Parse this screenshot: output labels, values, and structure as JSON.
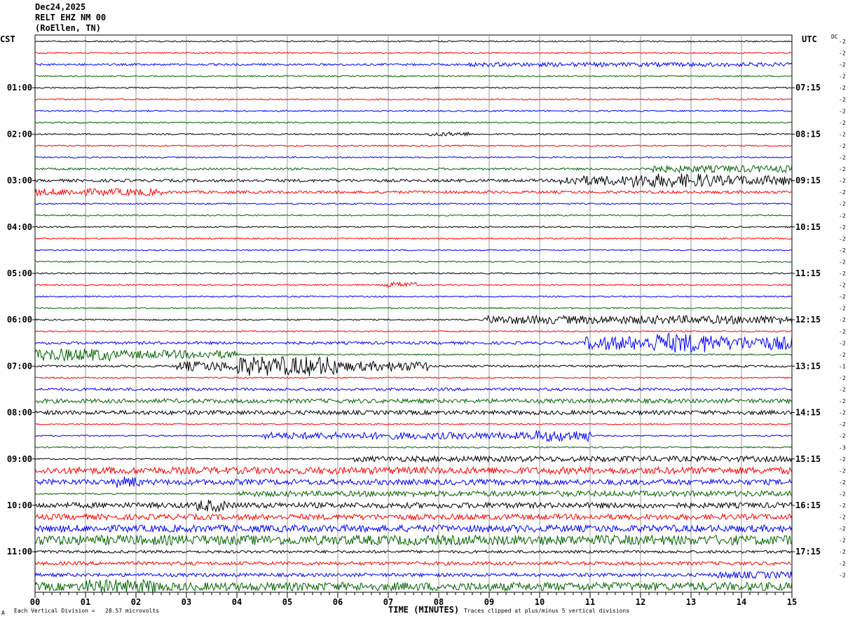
{
  "header": {
    "date": "Dec24,2025",
    "station": "RELT EHZ NM 00",
    "location": "(RoEllen, TN)"
  },
  "left_label": "CST",
  "right_label": "UTC",
  "dc_label": "DC",
  "footer": {
    "scale_text": "Each Vertical Division =   28.57 microvolts",
    "xlabel": "TIME (MINUTES)",
    "clip_text": "Traces clipped at plus/minus 5 vertical divisions",
    "corner_mark": "A"
  },
  "colors": {
    "cycle": [
      "#000000",
      "#ff0000",
      "#0000ff",
      "#006400"
    ],
    "grid": "#999999"
  },
  "chart_data": {
    "type": "line",
    "title": "RELT EHZ NM 00",
    "xlabel": "TIME (MINUTES)",
    "xlim": [
      0,
      15
    ],
    "xticks": [
      "00",
      "01",
      "02",
      "03",
      "04",
      "05",
      "06",
      "07",
      "08",
      "09",
      "10",
      "11",
      "12",
      "13",
      "14",
      "15"
    ],
    "cst_labels": [
      "01:00",
      "02:00",
      "03:00",
      "04:00",
      "05:00",
      "06:00",
      "07:00",
      "08:00",
      "09:00",
      "10:00",
      "11:00"
    ],
    "utc_labels": [
      "07:15",
      "08:15",
      "09:15",
      "10:15",
      "11:15",
      "12:15",
      "13:15",
      "14:15",
      "15:15",
      "16:15",
      "17:15"
    ],
    "dc_offsets": [
      "-2",
      "-2",
      "-2",
      "-2",
      "-2",
      "-2",
      "-2",
      "-2",
      "-2",
      "-2",
      "-2",
      "-2",
      "-2",
      "-2",
      "-2",
      "-2",
      "-2",
      "-2",
      "-2",
      "-2",
      "-2",
      "-2",
      "-2",
      "-2",
      "-2",
      "-2",
      "-2",
      "-2",
      "-1",
      "-2",
      "-2",
      "-2",
      "-2",
      "-2",
      "-2",
      "-3",
      "-2",
      "-2",
      "-2",
      "-2",
      "-2",
      "-2",
      "-2",
      "-2",
      "-2",
      "-2",
      "-2"
    ],
    "trace_count": 48,
    "trace_amplitude": [
      1,
      1,
      1.5,
      1,
      1,
      1,
      1,
      1,
      1,
      1,
      1,
      1.5,
      2,
      2,
      1,
      1,
      1,
      1,
      1,
      1,
      1,
      1,
      1,
      1,
      1,
      1,
      2,
      1,
      1.5,
      1,
      2,
      3,
      3,
      1,
      1,
      1,
      1,
      1,
      1,
      1,
      1,
      1,
      2,
      1,
      2,
      2.5,
      2.5,
      2.5,
      2,
      2.5,
      2.5,
      2.5,
      3,
      1,
      1,
      1,
      2,
      2.5
    ],
    "events": [
      {
        "trace": 2,
        "start": 8.6,
        "end": 15,
        "amp": 3
      },
      {
        "trace": 8,
        "start": 7.8,
        "end": 8.6,
        "amp": 3
      },
      {
        "trace": 11,
        "start": 12.0,
        "end": 15,
        "amp": 5
      },
      {
        "trace": 12,
        "start": 10.4,
        "end": 15,
        "amp": 7
      },
      {
        "trace": 12,
        "start": 11.8,
        "end": 13.4,
        "amp": 10
      },
      {
        "trace": 13,
        "start": 0,
        "end": 2.5,
        "amp": 5
      },
      {
        "trace": 21,
        "start": 6.9,
        "end": 7.6,
        "amp": 4
      },
      {
        "trace": 24,
        "start": 8.9,
        "end": 15,
        "amp": 6
      },
      {
        "trace": 26,
        "start": 10.9,
        "end": 15,
        "amp": 10
      },
      {
        "trace": 26,
        "start": 12.2,
        "end": 13.4,
        "amp": 14
      },
      {
        "trace": 27,
        "start": 0,
        "end": 1.5,
        "amp": 9
      },
      {
        "trace": 27,
        "start": 1.5,
        "end": 4.0,
        "amp": 6
      },
      {
        "trace": 28,
        "start": 2.8,
        "end": 7.8,
        "amp": 7
      },
      {
        "trace": 28,
        "start": 4.0,
        "end": 6.0,
        "amp": 14
      },
      {
        "trace": 31,
        "start": 3.0,
        "end": 4.3,
        "amp": 3
      },
      {
        "trace": 34,
        "start": 4.5,
        "end": 11.0,
        "amp": 5
      },
      {
        "trace": 34,
        "start": 9.8,
        "end": 11.0,
        "amp": 8
      },
      {
        "trace": 36,
        "start": 6.3,
        "end": 15,
        "amp": 4
      },
      {
        "trace": 37,
        "start": 0,
        "end": 15,
        "amp": 5
      },
      {
        "trace": 38,
        "start": 0,
        "end": 15,
        "amp": 4
      },
      {
        "trace": 38,
        "start": 1.6,
        "end": 2.1,
        "amp": 8
      },
      {
        "trace": 39,
        "start": 4.0,
        "end": 15,
        "amp": 4
      },
      {
        "trace": 40,
        "start": 0,
        "end": 15,
        "amp": 4
      },
      {
        "trace": 40,
        "start": 3.2,
        "end": 3.8,
        "amp": 9
      },
      {
        "trace": 41,
        "start": 0,
        "end": 15,
        "amp": 4
      },
      {
        "trace": 42,
        "start": 0,
        "end": 15,
        "amp": 5
      },
      {
        "trace": 43,
        "start": 0,
        "end": 15,
        "amp": 7
      },
      {
        "trace": 46,
        "start": 13.5,
        "end": 15,
        "amp": 5
      },
      {
        "trace": 47,
        "start": 0,
        "end": 15,
        "amp": 6
      },
      {
        "trace": 47,
        "start": 1.0,
        "end": 2.5,
        "amp": 10
      }
    ]
  }
}
